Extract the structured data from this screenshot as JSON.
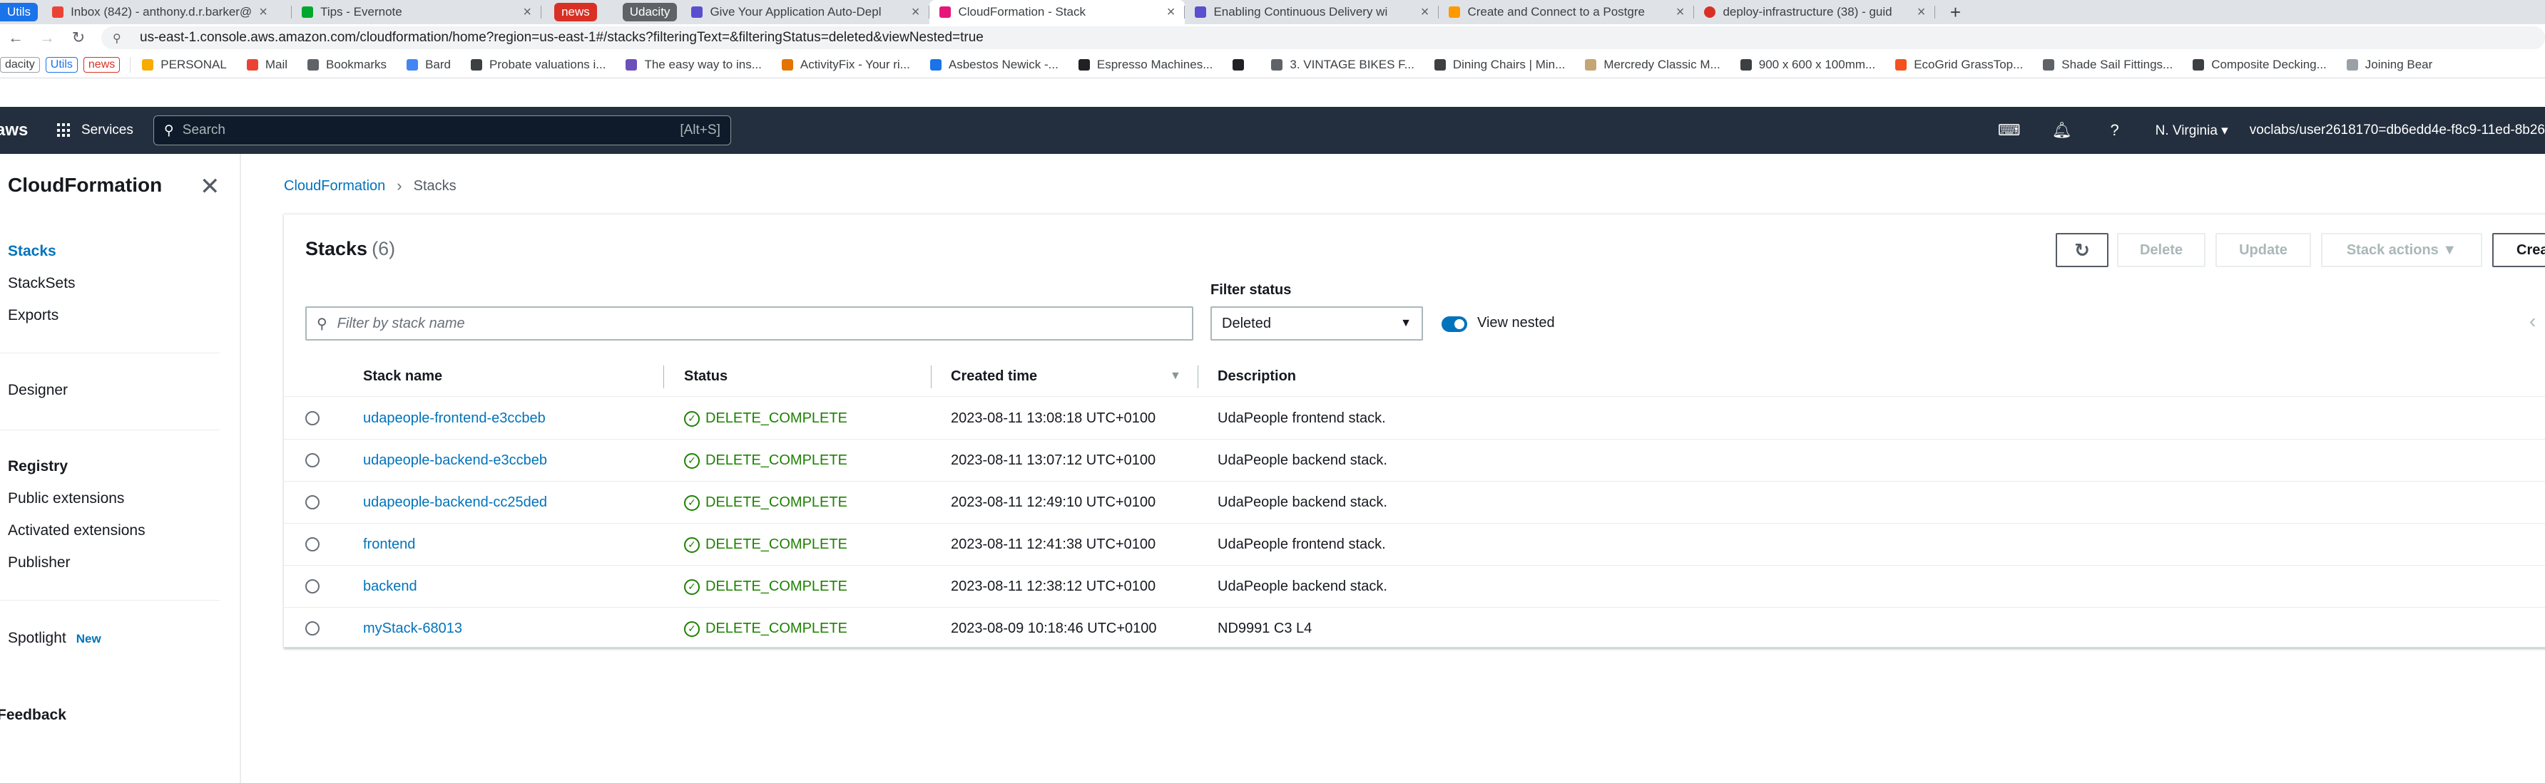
{
  "browser": {
    "tab_groups": [
      {
        "label": "Utils",
        "color": "#1a73e8"
      },
      {
        "label": "news",
        "color": "#d93025"
      },
      {
        "label": "Udacity",
        "color": "#5f6368"
      }
    ],
    "tabs": [
      {
        "title": "Inbox (842) - anthony.d.r.barker@",
        "icon_color": "#ea4335"
      },
      {
        "title": "Tips - Evernote",
        "icon_color": "#00a82d"
      },
      {
        "title": "Give Your Application Auto-Depl",
        "icon_color": "#5a4fcf"
      },
      {
        "title": "CloudFormation - Stack",
        "icon_color": "#e7157b"
      },
      {
        "title": "Enabling Continuous Delivery wi",
        "icon_color": "#5a4fcf"
      },
      {
        "title": "Create and Connect to a Postgre",
        "icon_color": "#ff9900"
      },
      {
        "title": "deploy-infrastructure (38) - guid",
        "icon_color": "#d93025"
      }
    ],
    "new_tab": "+",
    "url": "us-east-1.console.aws.amazon.com/cloudformation/home?region=us-east-1#/stacks?filteringText=&filteringStatus=deleted&viewNested=true",
    "bookmarks_chips": [
      "dacity",
      "Utils",
      "news"
    ],
    "bookmarks": [
      {
        "label": "PERSONAL",
        "icon_color": "#f9ab00"
      },
      {
        "label": "Mail",
        "icon_color": "#ea4335"
      },
      {
        "label": "Bookmarks",
        "icon_color": "#5f6368"
      },
      {
        "label": "Bard",
        "icon_color": "#4285f4"
      },
      {
        "label": "Probate valuations i...",
        "icon_color": "#3c4043"
      },
      {
        "label": "The easy way to ins...",
        "icon_color": "#6b4fbb"
      },
      {
        "label": "ActivityFix - Your ri...",
        "icon_color": "#e37400"
      },
      {
        "label": "Asbestos Newick -...",
        "icon_color": "#1a73e8"
      },
      {
        "label": "Espresso Machines...",
        "icon_color": "#202124"
      },
      {
        "label": "",
        "icon_color": "#202124"
      },
      {
        "label": "3. VINTAGE BIKES F...",
        "icon_color": "#5f6368"
      },
      {
        "label": "Dining Chairs | Min...",
        "icon_color": "#3c4043"
      },
      {
        "label": "Mercredy Classic M...",
        "icon_color": "#c5a572"
      },
      {
        "label": "900 x 600 x 100mm...",
        "icon_color": "#3c4043"
      },
      {
        "label": "EcoGrid GrassTop...",
        "icon_color": "#f4511e"
      },
      {
        "label": "Shade Sail Fittings...",
        "icon_color": "#5f6368"
      },
      {
        "label": "Composite Decking...",
        "icon_color": "#3c4043"
      },
      {
        "label": "Joining Bear",
        "icon_color": "#9aa0a6"
      }
    ]
  },
  "aws": {
    "logo": "aws",
    "services_label": "Services",
    "search_placeholder": "Search",
    "search_shortcut": "[Alt+S]",
    "region": "N. Virginia ▾",
    "account": "voclabs/user2618170=db6edd4e-f8c9-11ed-8b26"
  },
  "sidenav": {
    "title": "CloudFormation",
    "items_top": [
      "Stacks",
      "StackSets",
      "Exports"
    ],
    "designer": "Designer",
    "registry_heading": "Registry",
    "registry_items": [
      "Public extensions",
      "Activated extensions",
      "Publisher"
    ],
    "spotlight": "Spotlight",
    "spotlight_badge": "New",
    "feedback": "Feedback"
  },
  "breadcrumb": {
    "root": "CloudFormation",
    "current": "Stacks"
  },
  "stacks": {
    "title": "Stacks",
    "count": "(6)",
    "buttons": {
      "delete": "Delete",
      "update": "Update",
      "stack_actions": "Stack actions ▼",
      "create": "Crea"
    },
    "search_placeholder": "Filter by stack name",
    "filter_status_label": "Filter status",
    "filter_status_value": "Deleted",
    "view_nested_label": "View nested",
    "view_nested_on": true,
    "columns": [
      "Stack name",
      "Status",
      "Created time",
      "Description"
    ],
    "rows": [
      {
        "name": "udapeople-frontend-e3ccbeb",
        "status": "DELETE_COMPLETE",
        "created": "2023-08-11 13:08:18 UTC+0100",
        "description": "UdaPeople frontend stack."
      },
      {
        "name": "udapeople-backend-e3ccbeb",
        "status": "DELETE_COMPLETE",
        "created": "2023-08-11 13:07:12 UTC+0100",
        "description": "UdaPeople backend stack."
      },
      {
        "name": "udapeople-backend-cc25ded",
        "status": "DELETE_COMPLETE",
        "created": "2023-08-11 12:49:10 UTC+0100",
        "description": "UdaPeople backend stack."
      },
      {
        "name": "frontend",
        "status": "DELETE_COMPLETE",
        "created": "2023-08-11 12:41:38 UTC+0100",
        "description": "UdaPeople frontend stack."
      },
      {
        "name": "backend",
        "status": "DELETE_COMPLETE",
        "created": "2023-08-11 12:38:12 UTC+0100",
        "description": "UdaPeople backend stack."
      },
      {
        "name": "myStack-68013",
        "status": "DELETE_COMPLETE",
        "created": "2023-08-09 10:18:46 UTC+0100",
        "description": "ND9991 C3 L4"
      }
    ],
    "colors": {
      "link": "#0073bb",
      "success": "#1d8102",
      "nav_bg": "#232f3e"
    }
  }
}
